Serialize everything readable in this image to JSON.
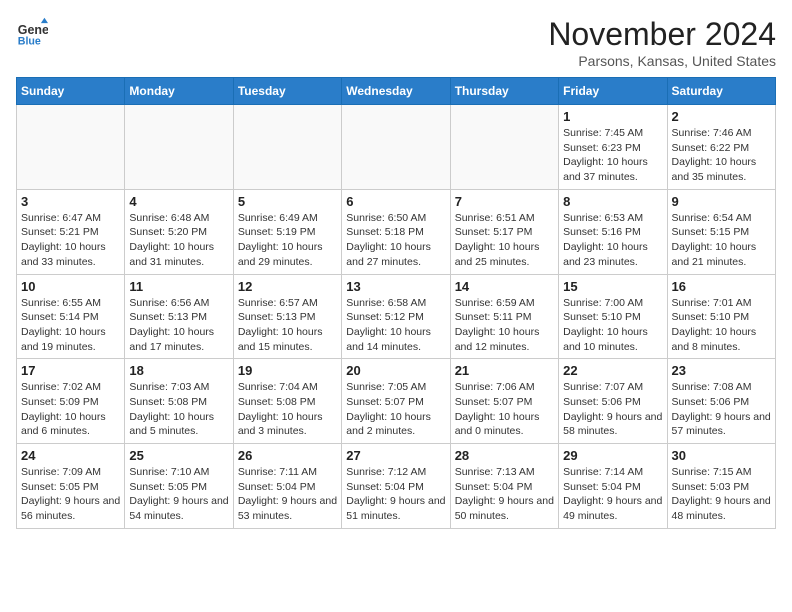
{
  "header": {
    "logo_line1": "General",
    "logo_line2": "Blue",
    "month": "November 2024",
    "location": "Parsons, Kansas, United States"
  },
  "days_of_week": [
    "Sunday",
    "Monday",
    "Tuesday",
    "Wednesday",
    "Thursday",
    "Friday",
    "Saturday"
  ],
  "weeks": [
    [
      {
        "day": "",
        "info": ""
      },
      {
        "day": "",
        "info": ""
      },
      {
        "day": "",
        "info": ""
      },
      {
        "day": "",
        "info": ""
      },
      {
        "day": "",
        "info": ""
      },
      {
        "day": "1",
        "info": "Sunrise: 7:45 AM\nSunset: 6:23 PM\nDaylight: 10 hours and 37 minutes."
      },
      {
        "day": "2",
        "info": "Sunrise: 7:46 AM\nSunset: 6:22 PM\nDaylight: 10 hours and 35 minutes."
      }
    ],
    [
      {
        "day": "3",
        "info": "Sunrise: 6:47 AM\nSunset: 5:21 PM\nDaylight: 10 hours and 33 minutes."
      },
      {
        "day": "4",
        "info": "Sunrise: 6:48 AM\nSunset: 5:20 PM\nDaylight: 10 hours and 31 minutes."
      },
      {
        "day": "5",
        "info": "Sunrise: 6:49 AM\nSunset: 5:19 PM\nDaylight: 10 hours and 29 minutes."
      },
      {
        "day": "6",
        "info": "Sunrise: 6:50 AM\nSunset: 5:18 PM\nDaylight: 10 hours and 27 minutes."
      },
      {
        "day": "7",
        "info": "Sunrise: 6:51 AM\nSunset: 5:17 PM\nDaylight: 10 hours and 25 minutes."
      },
      {
        "day": "8",
        "info": "Sunrise: 6:53 AM\nSunset: 5:16 PM\nDaylight: 10 hours and 23 minutes."
      },
      {
        "day": "9",
        "info": "Sunrise: 6:54 AM\nSunset: 5:15 PM\nDaylight: 10 hours and 21 minutes."
      }
    ],
    [
      {
        "day": "10",
        "info": "Sunrise: 6:55 AM\nSunset: 5:14 PM\nDaylight: 10 hours and 19 minutes."
      },
      {
        "day": "11",
        "info": "Sunrise: 6:56 AM\nSunset: 5:13 PM\nDaylight: 10 hours and 17 minutes."
      },
      {
        "day": "12",
        "info": "Sunrise: 6:57 AM\nSunset: 5:13 PM\nDaylight: 10 hours and 15 minutes."
      },
      {
        "day": "13",
        "info": "Sunrise: 6:58 AM\nSunset: 5:12 PM\nDaylight: 10 hours and 14 minutes."
      },
      {
        "day": "14",
        "info": "Sunrise: 6:59 AM\nSunset: 5:11 PM\nDaylight: 10 hours and 12 minutes."
      },
      {
        "day": "15",
        "info": "Sunrise: 7:00 AM\nSunset: 5:10 PM\nDaylight: 10 hours and 10 minutes."
      },
      {
        "day": "16",
        "info": "Sunrise: 7:01 AM\nSunset: 5:10 PM\nDaylight: 10 hours and 8 minutes."
      }
    ],
    [
      {
        "day": "17",
        "info": "Sunrise: 7:02 AM\nSunset: 5:09 PM\nDaylight: 10 hours and 6 minutes."
      },
      {
        "day": "18",
        "info": "Sunrise: 7:03 AM\nSunset: 5:08 PM\nDaylight: 10 hours and 5 minutes."
      },
      {
        "day": "19",
        "info": "Sunrise: 7:04 AM\nSunset: 5:08 PM\nDaylight: 10 hours and 3 minutes."
      },
      {
        "day": "20",
        "info": "Sunrise: 7:05 AM\nSunset: 5:07 PM\nDaylight: 10 hours and 2 minutes."
      },
      {
        "day": "21",
        "info": "Sunrise: 7:06 AM\nSunset: 5:07 PM\nDaylight: 10 hours and 0 minutes."
      },
      {
        "day": "22",
        "info": "Sunrise: 7:07 AM\nSunset: 5:06 PM\nDaylight: 9 hours and 58 minutes."
      },
      {
        "day": "23",
        "info": "Sunrise: 7:08 AM\nSunset: 5:06 PM\nDaylight: 9 hours and 57 minutes."
      }
    ],
    [
      {
        "day": "24",
        "info": "Sunrise: 7:09 AM\nSunset: 5:05 PM\nDaylight: 9 hours and 56 minutes."
      },
      {
        "day": "25",
        "info": "Sunrise: 7:10 AM\nSunset: 5:05 PM\nDaylight: 9 hours and 54 minutes."
      },
      {
        "day": "26",
        "info": "Sunrise: 7:11 AM\nSunset: 5:04 PM\nDaylight: 9 hours and 53 minutes."
      },
      {
        "day": "27",
        "info": "Sunrise: 7:12 AM\nSunset: 5:04 PM\nDaylight: 9 hours and 51 minutes."
      },
      {
        "day": "28",
        "info": "Sunrise: 7:13 AM\nSunset: 5:04 PM\nDaylight: 9 hours and 50 minutes."
      },
      {
        "day": "29",
        "info": "Sunrise: 7:14 AM\nSunset: 5:04 PM\nDaylight: 9 hours and 49 minutes."
      },
      {
        "day": "30",
        "info": "Sunrise: 7:15 AM\nSunset: 5:03 PM\nDaylight: 9 hours and 48 minutes."
      }
    ]
  ]
}
